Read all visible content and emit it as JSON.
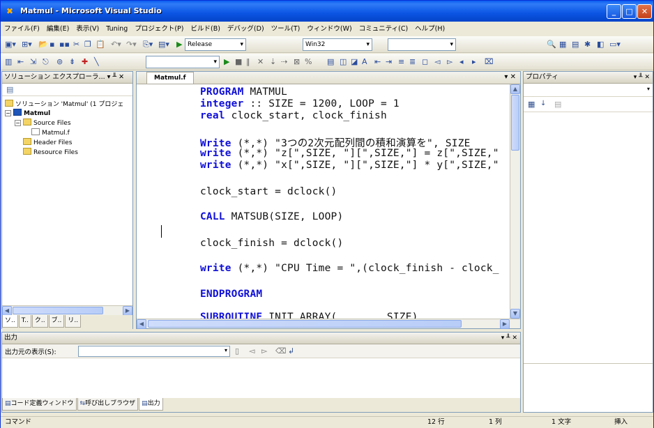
{
  "window": {
    "title": "Matmul - Microsoft Visual Studio"
  },
  "menu": [
    "ファイル(F)",
    "編集(E)",
    "表示(V)",
    "Tuning",
    "プロジェクト(P)",
    "ビルド(B)",
    "デバッグ(D)",
    "ツール(T)",
    "ウィンドウ(W)",
    "コミュニティ(C)",
    "ヘルプ(H)"
  ],
  "toolbar": {
    "config": "Release",
    "platform": "Win32"
  },
  "solution_explorer": {
    "title": "ソリューション エクスプローラ... ▾ ╨ ✕",
    "solution": "ソリューション 'Matmul' (1 プロジェ",
    "project": "Matmul",
    "source_files": "Source Files",
    "file": "Matmul.f",
    "header_files": "Header Files",
    "resource_files": "Resource Files",
    "tabs": [
      "ソ..",
      "T..",
      "ク..",
      "ブ..",
      "リ.."
    ]
  },
  "editor": {
    "tab": "Matmul.f",
    "lines": [
      {
        "kw": "PROGRAM",
        "rest": " MATMUL"
      },
      {
        "kw": "integer",
        "rest": " :: SIZE = 1200, LOOP = 1"
      },
      {
        "kw": "real",
        "rest": " clock_start, clock_finish"
      },
      {
        "kw": "Write",
        "rest": " (*,*) \"3つの2次元配列間の積和演算を\", SIZE"
      },
      {
        "kw": "write",
        "rest": " (*,*) \"z[\",SIZE, \"][\",SIZE,\"] = z[\",SIZE,\""
      },
      {
        "kw": "write",
        "rest": " (*,*) \"x[\",SIZE, \"][\",SIZE,\"] * y[\",SIZE,\""
      },
      {
        "kw": "",
        "rest": "clock_start = dclock()"
      },
      {
        "kw": "CALL",
        "rest": " MATSUB(SIZE, LOOP)"
      },
      {
        "kw": "",
        "rest": "clock_finish = dclock()"
      },
      {
        "kw": "write",
        "rest": " (*,*) \"CPU Time = \",(clock_finish - clock_"
      },
      {
        "kw": "ENDPROGRAM",
        "rest": ""
      },
      {
        "kw": "SUBROUTINE",
        "rest": " INIT_ARRAY(        SIZE)"
      }
    ]
  },
  "properties": {
    "title": "プロパティ"
  },
  "output": {
    "title": "出力",
    "source_label": "出力元の表示(S):",
    "tabs": [
      "コード定義ウィンドウ",
      "呼び出しブラウザ",
      "出力"
    ]
  },
  "status": {
    "left": "コマンド",
    "line": "12 行",
    "col": "1 列",
    "char": "1 文字",
    "mode": "挿入"
  }
}
